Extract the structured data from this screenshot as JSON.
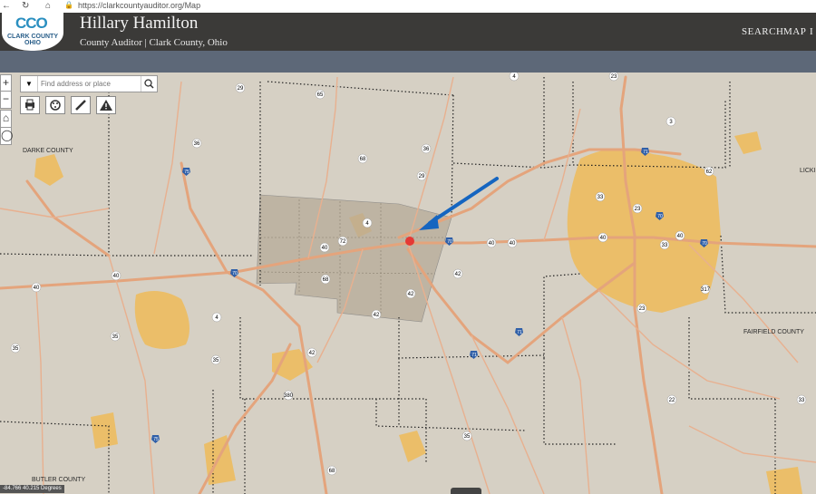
{
  "browser": {
    "url": "https://clarkcountyauditor.org/Map"
  },
  "header": {
    "logo_text": "CCO",
    "logo_county": "CLARK COUNTY",
    "logo_state": "OHIO",
    "title": "Hillary Hamilton",
    "subtitle": "County Auditor | Clark County, Ohio",
    "nav": [
      "SEARCH",
      "MAP",
      "I"
    ]
  },
  "map_controls": {
    "zoom_in": "+",
    "zoom_out": "−",
    "search_placeholder": "Find address or place",
    "tools": [
      "print-icon",
      "layers-icon",
      "measure-icon",
      "warning-icon"
    ]
  },
  "map": {
    "county_labels": [
      "DARKE COUNTY",
      "FAIRFIELD COUNTY",
      "BUTLER COUNTY",
      "LICKI"
    ],
    "coordinates": "-84.766 40.215 Degrees",
    "marker_color": "#e53935",
    "arrow_color": "#1565c0",
    "urban_color": "#f2b84b",
    "road_color": "#e0a07a"
  }
}
